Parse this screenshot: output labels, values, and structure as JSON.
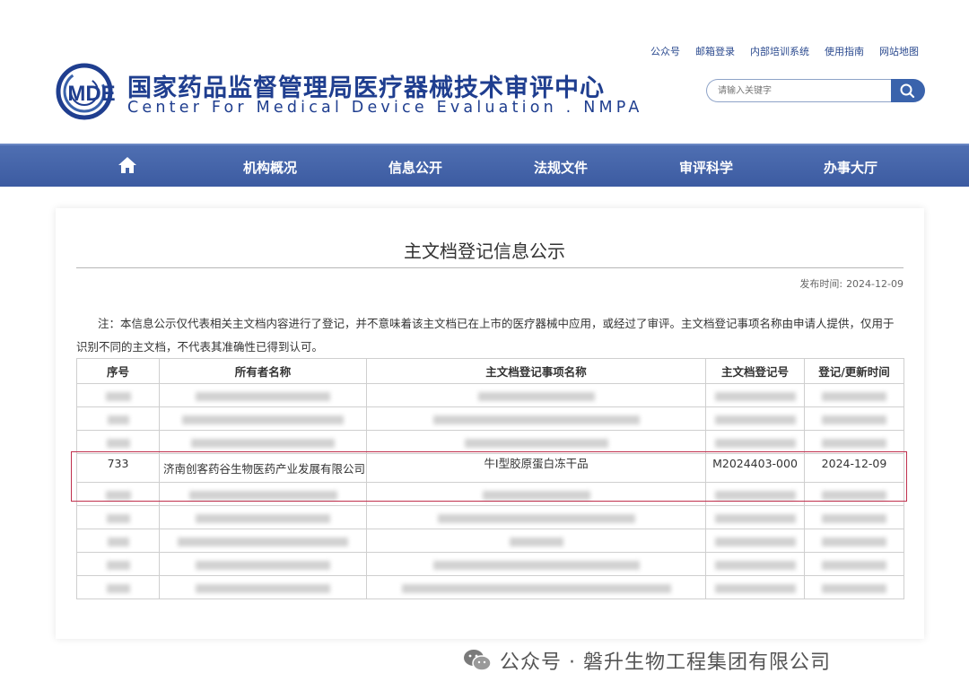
{
  "header": {
    "logo_text": "MDE",
    "site_title_cn": "国家药品监督管理局医疗器械技术审评中心",
    "site_title_en": "Center For Medical Device Evaluation . NMPA",
    "top_links": [
      "公众号",
      "邮箱登录",
      "内部培训系统",
      "使用指南",
      "网站地图"
    ],
    "search_placeholder": "请输入关键字"
  },
  "nav": {
    "items": [
      "机构概况",
      "信息公开",
      "法规文件",
      "审评科学",
      "办事大厅"
    ]
  },
  "content": {
    "title": "主文档登记信息公示",
    "pubdate_label": "发布时间:",
    "pubdate": "2024-12-09",
    "note": "注：本信息公示仅代表相关主文档内容进行了登记，并不意味着该主文档已在上市的医疗器械中应用，或经过了审评。主文档登记事项名称由申请人提供，仅用于识别不同的主文档，不代表其准确性已得到认可。"
  },
  "table": {
    "headers": [
      "序号",
      "所有者名称",
      "主文档登记事项名称",
      "主文档登记号",
      "登记/更新时间"
    ],
    "highlighted_row": {
      "no": "733",
      "owner": "济南创客药谷生物医药产业发展有限公司",
      "item": "牛Ⅰ型胶原蛋白冻干品",
      "reg_no": "M2024403-000",
      "date": "2024-12-09"
    }
  },
  "footer": {
    "watermark": "公众号 · 磐升生物工程集团有限公司"
  },
  "colors": {
    "brand": "#1f3e8f",
    "nav": "#4a68ad",
    "highlight": "#c0304d"
  }
}
